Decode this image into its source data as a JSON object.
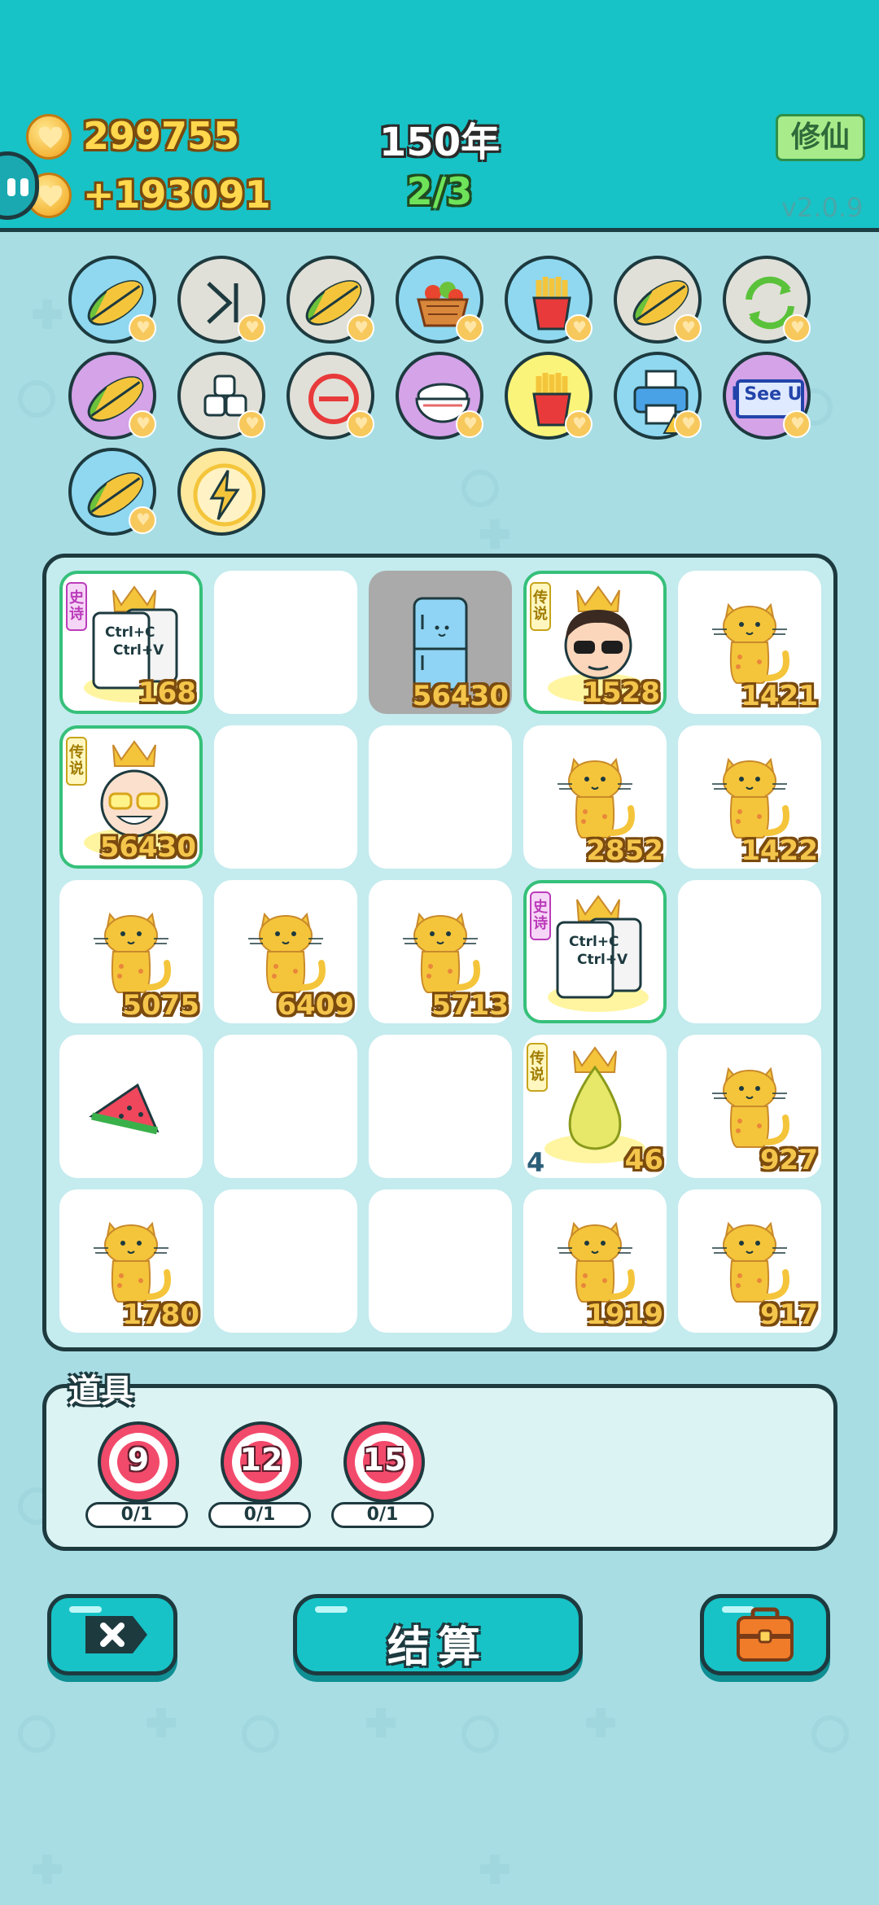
{
  "header": {
    "coins": "299755",
    "income": "+193091",
    "year": "150年",
    "stage": "2/3",
    "xiuxian_label": "修仙",
    "version": "v2.0.9"
  },
  "relics": [
    {
      "icon": "leaf-icon",
      "bg": "#8fd8f0"
    },
    {
      "icon": "skip-forward-icon",
      "bg": "#e0e0d8"
    },
    {
      "icon": "leaf-icon",
      "bg": "#e0e0d8"
    },
    {
      "icon": "fruit-basket-icon",
      "bg": "#8fd8f0"
    },
    {
      "icon": "french-fries-icon",
      "bg": "#8fd8f0"
    },
    {
      "icon": "leaf-icon",
      "bg": "#e0e0d8"
    },
    {
      "icon": "refresh-icon",
      "bg": "#e0e0d8"
    },
    {
      "icon": "leaf-icon",
      "bg": "#d4a3e8"
    },
    {
      "icon": "sugar-cubes-icon",
      "bg": "#e0e0d8"
    },
    {
      "icon": "minus-circle-icon",
      "bg": "#e0e0d8"
    },
    {
      "icon": "rice-bowl-icon",
      "bg": "#d4a3e8"
    },
    {
      "icon": "french-fries-icon",
      "bg": "#fbf47a"
    },
    {
      "icon": "printer-icon",
      "bg": "#8fd8f0"
    },
    {
      "icon": "i-see-u-icon",
      "bg": "#d4a3e8",
      "text": "I See U"
    },
    {
      "icon": "leaf-icon",
      "bg": "#8fd8f0"
    },
    {
      "icon": "lightning-icon",
      "bg": "#fde89b"
    }
  ],
  "board": [
    {
      "type": "copy-paste",
      "rarity": "epic",
      "tag": "史诗",
      "value": "168",
      "copy_text": "Ctrl+C",
      "paste_text": "Ctrl+V"
    },
    {
      "type": "empty"
    },
    {
      "type": "fridge",
      "value": "56430"
    },
    {
      "type": "boss-sunglasses",
      "rarity": "legend",
      "tag": "传说",
      "value": "1528"
    },
    {
      "type": "cat",
      "value": "1421"
    },
    {
      "type": "grandpa",
      "rarity": "legend",
      "tag": "传说",
      "value": "56430"
    },
    {
      "type": "empty"
    },
    {
      "type": "empty"
    },
    {
      "type": "cat",
      "value": "2852"
    },
    {
      "type": "cat",
      "value": "1422"
    },
    {
      "type": "cat",
      "value": "5075"
    },
    {
      "type": "cat",
      "value": "6409"
    },
    {
      "type": "cat",
      "value": "5713"
    },
    {
      "type": "copy-paste",
      "rarity": "epic",
      "tag": "史诗",
      "value": "",
      "copy_text": "Ctrl+C",
      "paste_text": "Ctrl+V"
    },
    {
      "type": "empty"
    },
    {
      "type": "watermelon",
      "value": ""
    },
    {
      "type": "empty"
    },
    {
      "type": "empty"
    },
    {
      "type": "pear",
      "tag": "传说",
      "value": "46",
      "count": "4"
    },
    {
      "type": "cat",
      "value": "927"
    },
    {
      "type": "cat",
      "value": "1780"
    },
    {
      "type": "empty"
    },
    {
      "type": "empty"
    },
    {
      "type": "cat",
      "value": "1919"
    },
    {
      "type": "cat",
      "value": "917"
    }
  ],
  "props": {
    "label": "道具",
    "items": [
      {
        "number": "9",
        "count": "0/1"
      },
      {
        "number": "12",
        "count": "0/1"
      },
      {
        "number": "15",
        "count": "0/1"
      }
    ]
  },
  "buttons": {
    "settle_label": "结算"
  },
  "colors": {
    "header": "#17c3c6",
    "background": "#a8dde4",
    "number_gold": "#f4c54b",
    "rare_border": "#36c07a"
  }
}
